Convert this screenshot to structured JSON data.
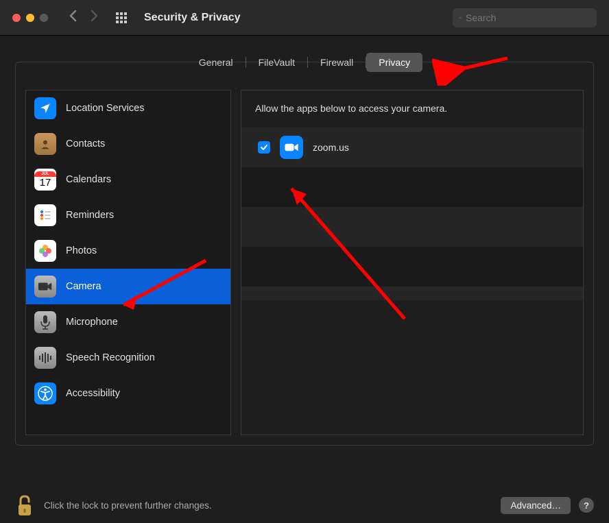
{
  "window": {
    "title": "Security & Privacy"
  },
  "search": {
    "placeholder": "Search"
  },
  "tabs": [
    {
      "label": "General"
    },
    {
      "label": "FileVault"
    },
    {
      "label": "Firewall"
    },
    {
      "label": "Privacy"
    }
  ],
  "sidebar": {
    "items": [
      {
        "label": "Location Services"
      },
      {
        "label": "Contacts"
      },
      {
        "label": "Calendars"
      },
      {
        "label": "Reminders"
      },
      {
        "label": "Photos"
      },
      {
        "label": "Camera"
      },
      {
        "label": "Microphone"
      },
      {
        "label": "Speech Recognition"
      },
      {
        "label": "Accessibility"
      }
    ]
  },
  "main": {
    "heading": "Allow the apps below to access your camera.",
    "apps": [
      {
        "name": "zoom.us",
        "checked": true
      }
    ]
  },
  "footer": {
    "lock_text": "Click the lock to prevent further changes.",
    "advanced_label": "Advanced…",
    "help_label": "?"
  },
  "calendar_icon": {
    "month": "JUL",
    "day": "17"
  }
}
